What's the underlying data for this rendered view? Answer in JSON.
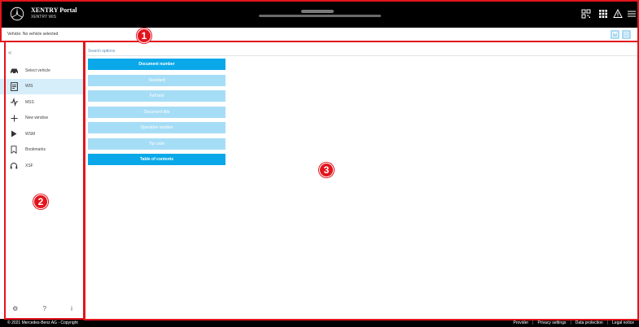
{
  "header": {
    "brand_title": "XENTRY Portal",
    "brand_sub": "XENTRY WIS",
    "icons": [
      "qr-code-icon",
      "grid-apps-icon",
      "warning-icon",
      "hamburger-menu-icon"
    ]
  },
  "vehicle_bar": {
    "label": "Vehicle:  No vehicle selected",
    "buttons": [
      "save-icon",
      "document-icon"
    ]
  },
  "sidebar": {
    "collapse_label": "«",
    "items": [
      {
        "label": "Select vehicle",
        "icon": "car-icon",
        "active": false
      },
      {
        "label": "WIS",
        "icon": "wis-book-icon",
        "active": true
      },
      {
        "label": "MSS",
        "icon": "mss-icon",
        "active": false
      },
      {
        "label": "New window",
        "icon": "plus-icon",
        "active": false
      },
      {
        "label": "WSM",
        "icon": "play-icon",
        "active": false
      },
      {
        "label": "Bookmarks",
        "icon": "bookmark-icon",
        "active": false
      },
      {
        "label": "XSF",
        "icon": "headset-icon",
        "active": false
      }
    ],
    "footer": {
      "settings": "⚙",
      "help": "?",
      "info": "i"
    }
  },
  "main": {
    "search_label": "Search options",
    "options": [
      {
        "label": "Document number",
        "state": "selected"
      },
      {
        "label": "Standard",
        "state": "normal"
      },
      {
        "label": "Full text",
        "state": "normal"
      },
      {
        "label": "Document title",
        "state": "normal"
      },
      {
        "label": "Operation number",
        "state": "normal"
      },
      {
        "label": "Tip code",
        "state": "normal"
      },
      {
        "label": "Table of contents",
        "state": "bold"
      }
    ]
  },
  "footer": {
    "copyright": "© 2021 Mercedes-Benz AG - Copyright",
    "links": [
      "Provider",
      "Privacy settings",
      "Data protection",
      "Legal notice"
    ]
  },
  "annotations": {
    "markers": [
      "1",
      "2",
      "3"
    ],
    "color": "#e3141c"
  },
  "colors": {
    "accent": "#0aa8e8",
    "accent_light": "#a6ddf6",
    "active_nav": "#d6eef9",
    "header_bg": "#000000"
  }
}
